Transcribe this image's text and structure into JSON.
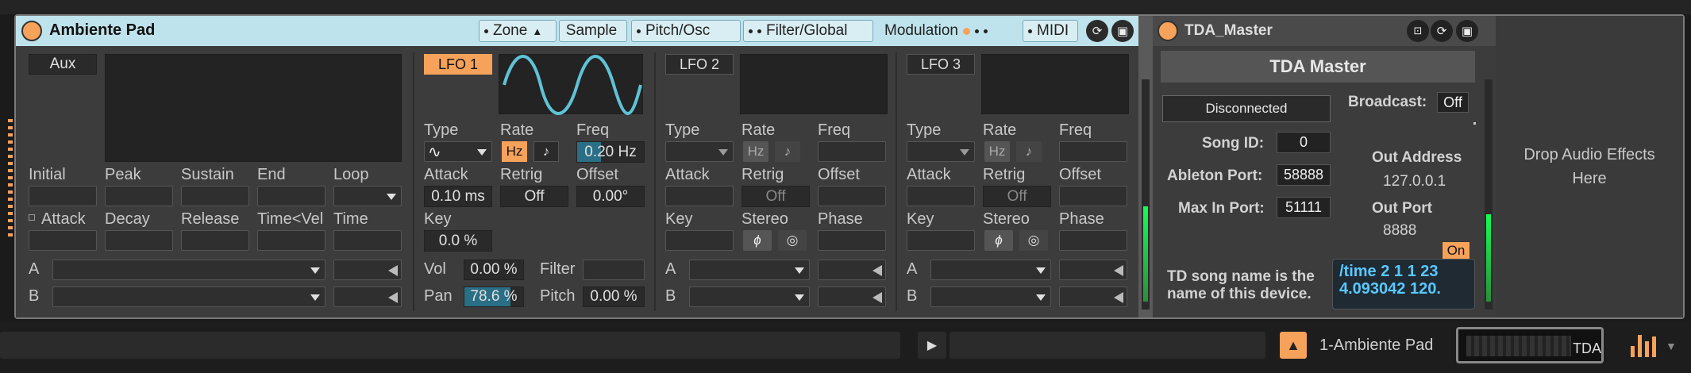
{
  "device": {
    "title": "Ambiente Pad",
    "tabs": [
      {
        "label": "Zone"
      },
      {
        "label": "Sample"
      },
      {
        "label": "Pitch/Osc"
      },
      {
        "label": "Filter/Global"
      },
      {
        "label": "Modulation"
      },
      {
        "label": "MIDI"
      }
    ]
  },
  "aux": {
    "button": "Aux",
    "labels": {
      "initial": "Initial",
      "peak": "Peak",
      "sustain": "Sustain",
      "end": "End",
      "loop": "Loop",
      "attack": "Attack",
      "decay": "Decay",
      "release": "Release",
      "time_vel": "Time<Vel",
      "time": "Time"
    },
    "a": "A",
    "b": "B"
  },
  "lfo1": {
    "name": "LFO 1",
    "type_label": "Type",
    "rate_label": "Rate",
    "rate_hz": "Hz",
    "freq_label": "Freq",
    "freq": "0.20 Hz",
    "attack_label": "Attack",
    "attack": "0.10 ms",
    "retrig_label": "Retrig",
    "retrig": "Off",
    "offset_label": "Offset",
    "offset": "0.00°",
    "key_label": "Key",
    "key": "0.0 %",
    "vol_label": "Vol",
    "vol": "0.00 %",
    "filter_label": "Filter",
    "pan_label": "Pan",
    "pan": "78.6 %",
    "pan_level": 0.786,
    "pitch_label": "Pitch",
    "pitch": "0.00 %"
  },
  "lfo2": {
    "name": "LFO 2",
    "type_label": "Type",
    "rate_label": "Rate",
    "rate_hz": "Hz",
    "freq_label": "Freq",
    "attack_label": "Attack",
    "retrig_label": "Retrig",
    "retrig": "Off",
    "offset_label": "Offset",
    "key_label": "Key",
    "stereo_label": "Stereo",
    "phase_label": "Phase",
    "a": "A",
    "b": "B"
  },
  "lfo3": {
    "name": "LFO 3",
    "type_label": "Type",
    "rate_label": "Rate",
    "rate_hz": "Hz",
    "freq_label": "Freq",
    "attack_label": "Attack",
    "retrig_label": "Retrig",
    "retrig": "Off",
    "offset_label": "Offset",
    "key_label": "Key",
    "stereo_label": "Stereo",
    "phase_label": "Phase",
    "a": "A",
    "b": "B"
  },
  "tda": {
    "title": "TDA_Master",
    "heading": "TDA Master",
    "status": "Disconnected",
    "broadcast_label": "Broadcast:",
    "broadcast": "Off",
    "song_id_label": "Song ID:",
    "song_id": "0",
    "ableton_port_label": "Ableton Port:",
    "ableton_port": "58888",
    "max_in_port_label": "Max In Port:",
    "max_in_port": "51111",
    "out_address_label": "Out Address",
    "out_address": "127.0.0.1",
    "out_port_label": "Out Port",
    "out_port": "8888",
    "on_button": "On",
    "note": "TD song name is the name of this device.",
    "osc_line1": "/time 2 1 1 23",
    "osc_line2": "4.093042 120."
  },
  "drop": {
    "line1": "Drop Audio Effects",
    "line2": "Here"
  },
  "bottom": {
    "clip_name": "1-Ambiente Pad",
    "thumb_label": "TDA"
  },
  "colors": {
    "accent": "#f6a25a",
    "title_bar": "#bfe3ec",
    "wave": "#5fc3d6",
    "osc_text": "#5ac8ff"
  }
}
